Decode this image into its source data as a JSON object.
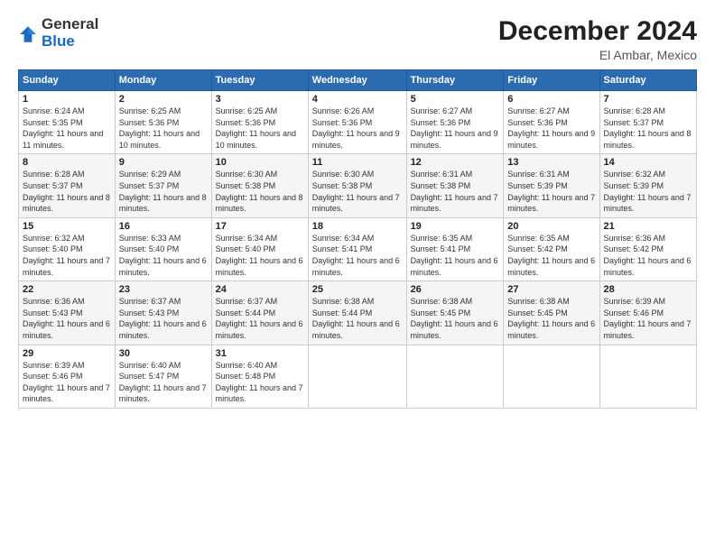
{
  "logo": {
    "general": "General",
    "blue": "Blue"
  },
  "title": "December 2024",
  "subtitle": "El Ambar, Mexico",
  "header_days": [
    "Sunday",
    "Monday",
    "Tuesday",
    "Wednesday",
    "Thursday",
    "Friday",
    "Saturday"
  ],
  "weeks": [
    [
      {
        "day": "1",
        "info": "Sunrise: 6:24 AM\nSunset: 5:35 PM\nDaylight: 11 hours and 11 minutes."
      },
      {
        "day": "2",
        "info": "Sunrise: 6:25 AM\nSunset: 5:36 PM\nDaylight: 11 hours and 10 minutes."
      },
      {
        "day": "3",
        "info": "Sunrise: 6:25 AM\nSunset: 5:36 PM\nDaylight: 11 hours and 10 minutes."
      },
      {
        "day": "4",
        "info": "Sunrise: 6:26 AM\nSunset: 5:36 PM\nDaylight: 11 hours and 9 minutes."
      },
      {
        "day": "5",
        "info": "Sunrise: 6:27 AM\nSunset: 5:36 PM\nDaylight: 11 hours and 9 minutes."
      },
      {
        "day": "6",
        "info": "Sunrise: 6:27 AM\nSunset: 5:36 PM\nDaylight: 11 hours and 9 minutes."
      },
      {
        "day": "7",
        "info": "Sunrise: 6:28 AM\nSunset: 5:37 PM\nDaylight: 11 hours and 8 minutes."
      }
    ],
    [
      {
        "day": "8",
        "info": "Sunrise: 6:28 AM\nSunset: 5:37 PM\nDaylight: 11 hours and 8 minutes."
      },
      {
        "day": "9",
        "info": "Sunrise: 6:29 AM\nSunset: 5:37 PM\nDaylight: 11 hours and 8 minutes."
      },
      {
        "day": "10",
        "info": "Sunrise: 6:30 AM\nSunset: 5:38 PM\nDaylight: 11 hours and 8 minutes."
      },
      {
        "day": "11",
        "info": "Sunrise: 6:30 AM\nSunset: 5:38 PM\nDaylight: 11 hours and 7 minutes."
      },
      {
        "day": "12",
        "info": "Sunrise: 6:31 AM\nSunset: 5:38 PM\nDaylight: 11 hours and 7 minutes."
      },
      {
        "day": "13",
        "info": "Sunrise: 6:31 AM\nSunset: 5:39 PM\nDaylight: 11 hours and 7 minutes."
      },
      {
        "day": "14",
        "info": "Sunrise: 6:32 AM\nSunset: 5:39 PM\nDaylight: 11 hours and 7 minutes."
      }
    ],
    [
      {
        "day": "15",
        "info": "Sunrise: 6:32 AM\nSunset: 5:40 PM\nDaylight: 11 hours and 7 minutes."
      },
      {
        "day": "16",
        "info": "Sunrise: 6:33 AM\nSunset: 5:40 PM\nDaylight: 11 hours and 6 minutes."
      },
      {
        "day": "17",
        "info": "Sunrise: 6:34 AM\nSunset: 5:40 PM\nDaylight: 11 hours and 6 minutes."
      },
      {
        "day": "18",
        "info": "Sunrise: 6:34 AM\nSunset: 5:41 PM\nDaylight: 11 hours and 6 minutes."
      },
      {
        "day": "19",
        "info": "Sunrise: 6:35 AM\nSunset: 5:41 PM\nDaylight: 11 hours and 6 minutes."
      },
      {
        "day": "20",
        "info": "Sunrise: 6:35 AM\nSunset: 5:42 PM\nDaylight: 11 hours and 6 minutes."
      },
      {
        "day": "21",
        "info": "Sunrise: 6:36 AM\nSunset: 5:42 PM\nDaylight: 11 hours and 6 minutes."
      }
    ],
    [
      {
        "day": "22",
        "info": "Sunrise: 6:36 AM\nSunset: 5:43 PM\nDaylight: 11 hours and 6 minutes."
      },
      {
        "day": "23",
        "info": "Sunrise: 6:37 AM\nSunset: 5:43 PM\nDaylight: 11 hours and 6 minutes."
      },
      {
        "day": "24",
        "info": "Sunrise: 6:37 AM\nSunset: 5:44 PM\nDaylight: 11 hours and 6 minutes."
      },
      {
        "day": "25",
        "info": "Sunrise: 6:38 AM\nSunset: 5:44 PM\nDaylight: 11 hours and 6 minutes."
      },
      {
        "day": "26",
        "info": "Sunrise: 6:38 AM\nSunset: 5:45 PM\nDaylight: 11 hours and 6 minutes."
      },
      {
        "day": "27",
        "info": "Sunrise: 6:38 AM\nSunset: 5:45 PM\nDaylight: 11 hours and 6 minutes."
      },
      {
        "day": "28",
        "info": "Sunrise: 6:39 AM\nSunset: 5:46 PM\nDaylight: 11 hours and 7 minutes."
      }
    ],
    [
      {
        "day": "29",
        "info": "Sunrise: 6:39 AM\nSunset: 5:46 PM\nDaylight: 11 hours and 7 minutes."
      },
      {
        "day": "30",
        "info": "Sunrise: 6:40 AM\nSunset: 5:47 PM\nDaylight: 11 hours and 7 minutes."
      },
      {
        "day": "31",
        "info": "Sunrise: 6:40 AM\nSunset: 5:48 PM\nDaylight: 11 hours and 7 minutes."
      },
      {
        "day": "",
        "info": ""
      },
      {
        "day": "",
        "info": ""
      },
      {
        "day": "",
        "info": ""
      },
      {
        "day": "",
        "info": ""
      }
    ]
  ]
}
